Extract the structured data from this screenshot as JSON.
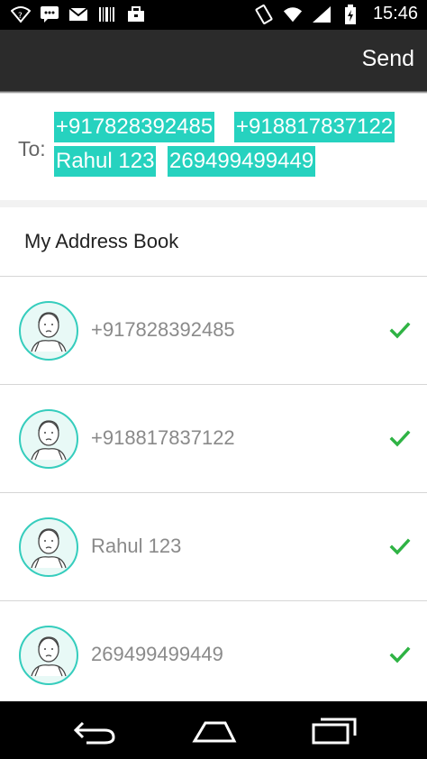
{
  "status_bar": {
    "left_icons": [
      "wifi-question-icon",
      "chat-icon",
      "mail-icon",
      "barcode-icon",
      "briefcase-icon"
    ],
    "right_icons": [
      "rotate-icon",
      "wifi-icon",
      "signal-icon",
      "battery-icon"
    ],
    "time": "15:46"
  },
  "action_bar": {
    "send_label": "Send",
    "background": "#2b2b2b"
  },
  "compose": {
    "to_label": "To:",
    "chips": [
      "+917828392485",
      "+918817837122",
      "Rahul 123",
      "269499499449"
    ],
    "chip_color": "#26d2bf"
  },
  "address_book": {
    "title": "My Address Book",
    "contacts": [
      {
        "label": "+917828392485",
        "selected": true
      },
      {
        "label": "+918817837122",
        "selected": true
      },
      {
        "label": "Rahul 123",
        "selected": true
      },
      {
        "label": "269499499449",
        "selected": true
      }
    ],
    "check_color": "#2fb344"
  },
  "nav_bar": {
    "buttons": [
      "back-icon",
      "home-icon",
      "recent-apps-icon"
    ]
  }
}
